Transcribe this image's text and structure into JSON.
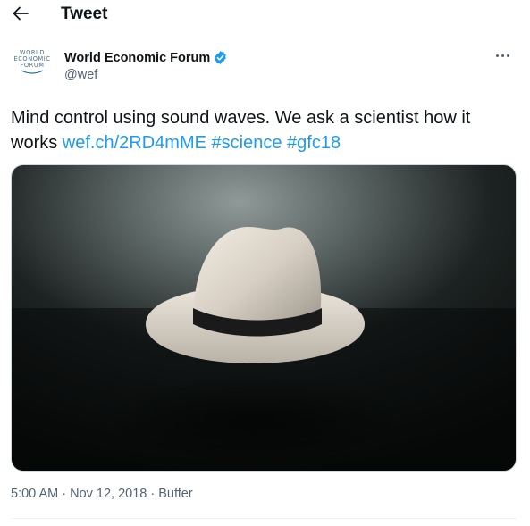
{
  "header": {
    "title": "Tweet",
    "back_icon": "arrow-left-icon"
  },
  "author": {
    "display_name": "World Economic Forum",
    "handle": "@wef",
    "verified": true,
    "avatar_logo_lines": [
      "WORLD",
      "ECONOMIC",
      "FORUM"
    ],
    "more_icon": "more-horizontal-icon"
  },
  "tweet": {
    "text": "Mind control using sound waves. We ask a scientist how it works",
    "link": "wef.ch/2RD4mME",
    "hashtags": [
      "#science",
      "#gfc18"
    ],
    "media_description_icon": "image-photo"
  },
  "meta": {
    "time": "5:00 AM",
    "sep1": " · ",
    "date": "Nov 12, 2018",
    "sep2": " · ",
    "source": "Buffer"
  },
  "colors": {
    "accent": "#1d9bf0",
    "text_primary": "#0f1419",
    "text_secondary": "#536471"
  }
}
